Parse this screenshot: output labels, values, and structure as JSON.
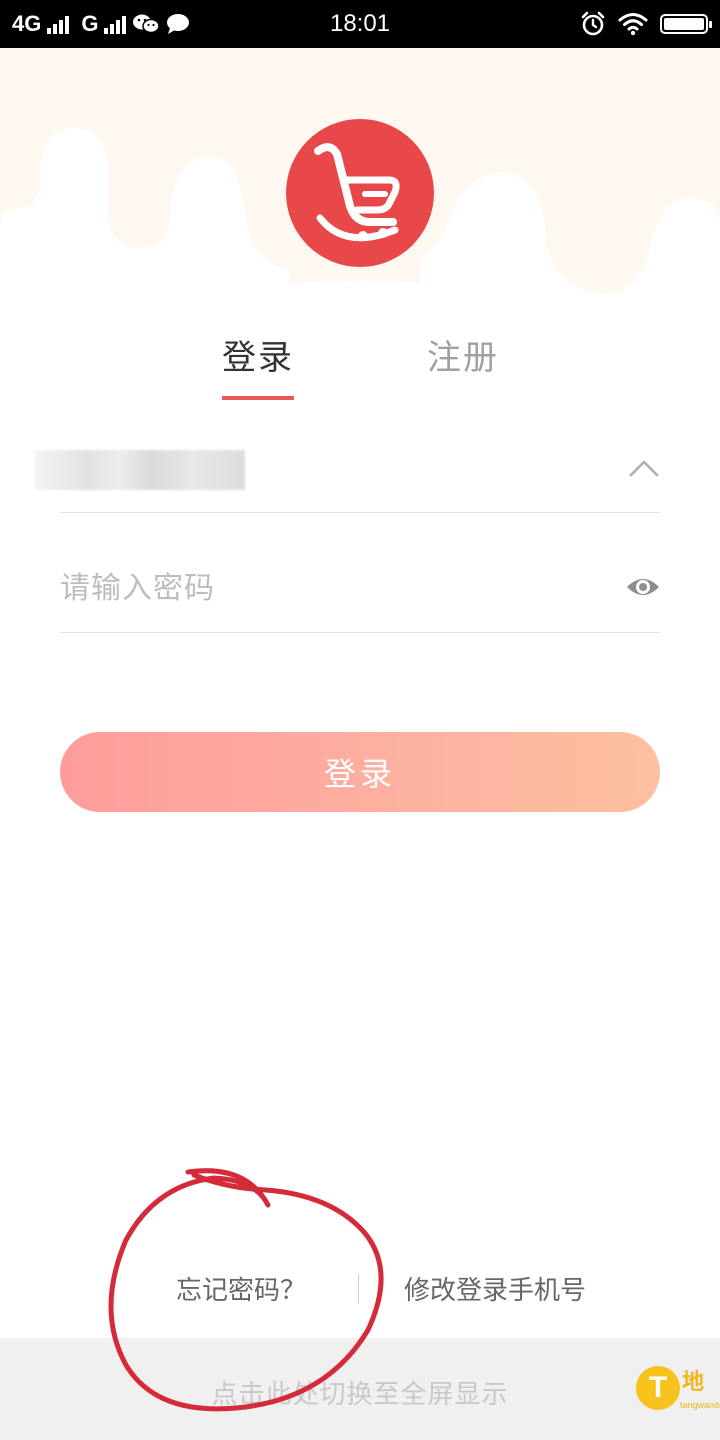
{
  "status_bar": {
    "network_1": "4G",
    "network_2": "G",
    "time": "18:01"
  },
  "tabs": {
    "login_label": "登录",
    "register_label": "注册",
    "active": "login"
  },
  "form": {
    "account_value": "",
    "password_placeholder": "请输入密码",
    "submit_label": "登录"
  },
  "links": {
    "forgot_password": "忘记密码？",
    "change_phone": "修改登录手机号"
  },
  "footer": {
    "fullscreen_hint": "点击此处切换至全屏显示"
  },
  "watermark": {
    "text": "地",
    "sub": "tangwanda"
  },
  "icons": {
    "logo": "shopping-cart-smile-icon",
    "account_toggle": "chevron-up-icon",
    "password_toggle": "eye-icon"
  },
  "colors": {
    "brand_red": "#e8484a",
    "accent_underline": "#e85a5a",
    "button_gradient_start": "#fe9c9c",
    "button_gradient_end": "#fdc0a0",
    "annotation_red": "#d42a3a"
  }
}
